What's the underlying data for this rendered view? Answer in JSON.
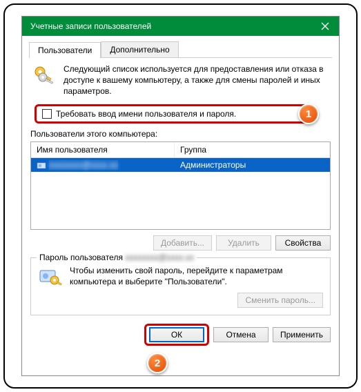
{
  "title": "Учетные записи пользователей",
  "tabs": {
    "users": "Пользователи",
    "advanced": "Дополнительно"
  },
  "info_text": "Следующий список используется для предоставления или отказа в доступе к вашему компьютеру, а также для смены паролей и иных параметров.",
  "checkbox_label": "Требовать ввод имени пользователя и пароля.",
  "users_label": "Пользователи этого компьютера:",
  "columns": {
    "username": "Имя пользователя",
    "group": "Группа"
  },
  "row": {
    "username_masked": "xxxxxxxx@xxxx.xx",
    "group": "Администраторы"
  },
  "buttons": {
    "add": "Добавить...",
    "remove": "Удалить",
    "properties": "Свойства",
    "change_password": "Сменить пароль...",
    "ok": "ОК",
    "cancel": "Отмена",
    "apply": "Применить"
  },
  "password_section": {
    "legend_prefix": "Пароль пользователя",
    "legend_user_masked": "xxxxxxxx@xxxx.xx",
    "text": "Чтобы изменить свой пароль, перейдите к параметрам компьютера и выберите \"Пользователи\"."
  },
  "badges": {
    "one": "1",
    "two": "2"
  }
}
